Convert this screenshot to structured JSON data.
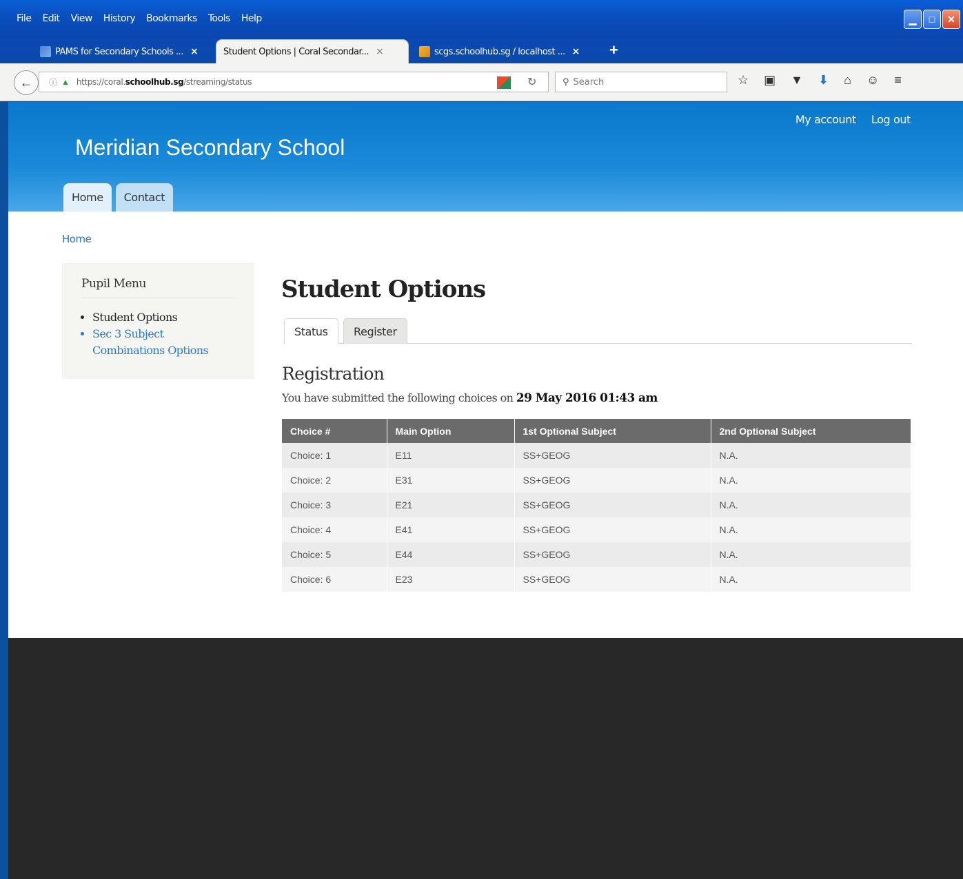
{
  "browser": {
    "menu": [
      "File",
      "Edit",
      "View",
      "History",
      "Bookmarks",
      "Tools",
      "Help"
    ],
    "tabs": [
      {
        "label": "PAMS for Secondary Schools ...",
        "close": "×"
      },
      {
        "label": "Student Options | Coral Secondar...",
        "close": "×"
      },
      {
        "label": "scgs.schoolhub.sg / localhost ...",
        "close": "×"
      }
    ],
    "new_tab": "+",
    "url_prefix": "https://coral.",
    "url_domain": "schoolhub.sg",
    "url_path": "/streaming/status",
    "search_placeholder": "Search"
  },
  "site": {
    "name": "Meridian Secondary School",
    "secondary_menu": [
      "My account",
      "Log out"
    ],
    "main_menu": [
      "Home",
      "Contact"
    ],
    "breadcrumb": "Home"
  },
  "sidebar": {
    "title": "Pupil Menu",
    "items": [
      "Student Options",
      "Sec 3 Subject Combinations Options"
    ]
  },
  "content": {
    "title": "Student Options",
    "tabs": [
      "Status",
      "Register"
    ],
    "section_heading": "Registration",
    "intro_text": "You have submitted the following choices on ",
    "submitted_date": "29 May 2016 01:43 am"
  },
  "table": {
    "headers": [
      "Choice #",
      "Main Option",
      "1st Optional Subject",
      "2nd Optional Subject"
    ],
    "rows": [
      [
        "Choice: 1",
        "E11",
        "SS+GEOG",
        "N.A."
      ],
      [
        "Choice: 2",
        "E31",
        "SS+GEOG",
        "N.A."
      ],
      [
        "Choice: 3",
        "E21",
        "SS+GEOG",
        "N.A."
      ],
      [
        "Choice: 4",
        "E41",
        "SS+GEOG",
        "N.A."
      ],
      [
        "Choice: 5",
        "E44",
        "SS+GEOG",
        "N.A."
      ],
      [
        "Choice: 6",
        "E23",
        "SS+GEOG",
        "N.A."
      ]
    ]
  },
  "colors": {
    "header_blue": "#1a8ad8",
    "link_blue": "#2a7ac8",
    "table_header": "#6b6b6b",
    "footer": "#282828"
  }
}
